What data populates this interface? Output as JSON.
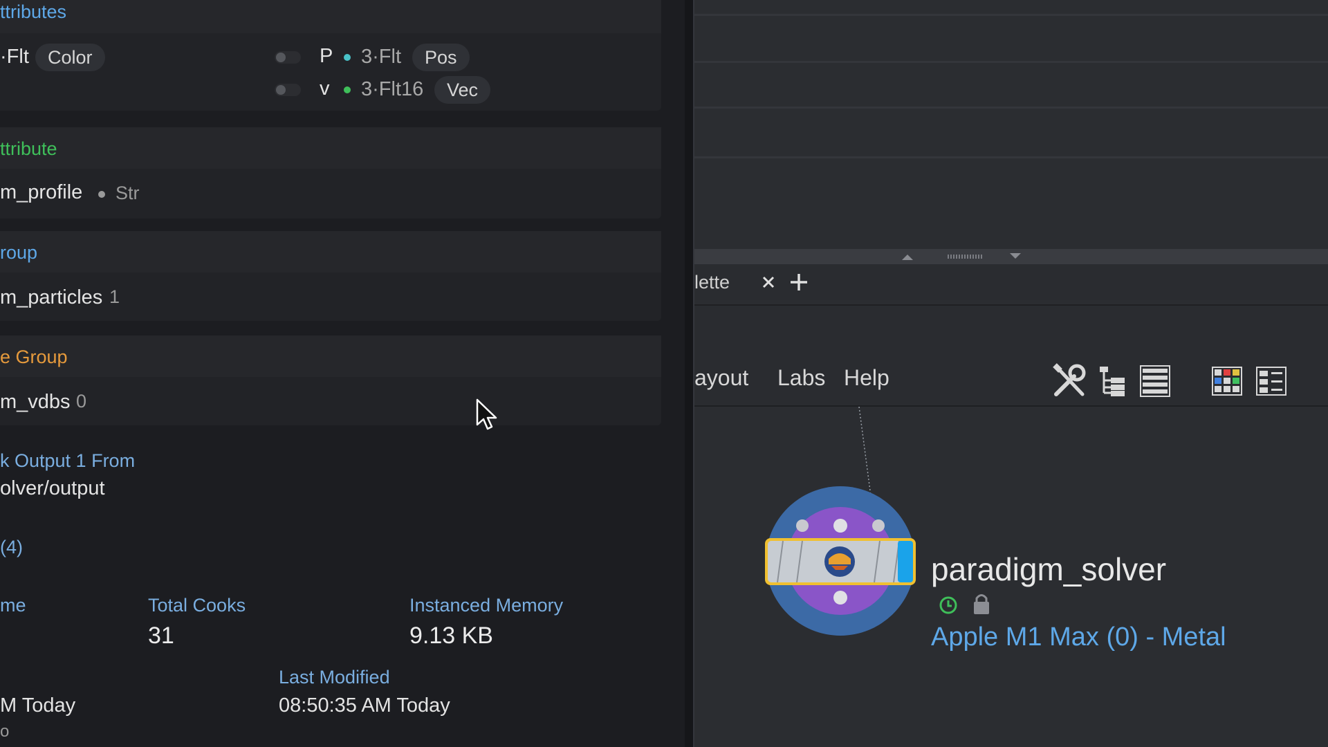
{
  "details": {
    "attributes_title": "ttributes",
    "row1": {
      "left_type": "·Flt",
      "left_tag": "Color",
      "name": "P",
      "type": "3·Flt",
      "tag": "Pos"
    },
    "row2": {
      "name": "v",
      "type": "3·Flt16",
      "tag": "Vec"
    },
    "detail_attr_title": "ttribute",
    "detail_attr": {
      "name": "m_profile",
      "type": "Str"
    },
    "group_title": "roup",
    "group": {
      "name": "m_particles",
      "count": "1"
    },
    "volume_group_title": "e Group",
    "volume_group": {
      "name": "m_vdbs",
      "count": "0"
    },
    "output_label": "k Output 1 From",
    "output_path": "olver/output",
    "stats_count": "(4)",
    "stats": {
      "time_label": "me",
      "cooks_label": "Total Cooks",
      "cooks_value": "31",
      "memory_label": "Instanced Memory",
      "memory_value": "9.13 KB",
      "modified_label": "Last Modified",
      "created_value": "M Today",
      "modified_value": "08:50:35 AM Today",
      "trailing": "o"
    }
  },
  "right": {
    "tabs": [
      {
        "label": "lette"
      }
    ],
    "menus": [
      "ayout",
      "Labs",
      "Help"
    ],
    "node": {
      "name": "paradigm_solver",
      "device": "Apple M1 Max (0) - Metal"
    }
  },
  "colors": {
    "accent_blue": "#5ea8e8",
    "green": "#3fbf5a",
    "orange": "#e69a3c",
    "node_outer": "#3c6aa6",
    "node_inner": "#8a55c8",
    "node_highlight": "#f0c030"
  },
  "icons": [
    "close-icon",
    "plus-icon",
    "tools-icon",
    "tree-view-icon",
    "list-view-icon",
    "grid-view-icon",
    "thumbnail-view-icon",
    "clock-icon",
    "lock-icon",
    "mouse-cursor-icon"
  ]
}
